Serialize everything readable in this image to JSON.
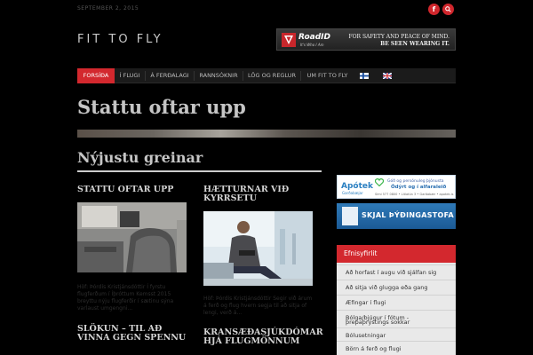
{
  "header": {
    "date": "SEPTEMBER 2, 2015",
    "site_title": "FIT TO FLY",
    "social": [
      {
        "icon": "facebook-icon",
        "glyph": "f"
      },
      {
        "icon": "search-icon"
      }
    ]
  },
  "banner": {
    "brand": "RoadID",
    "tagline": "It's Who I Am",
    "line1": "FOR SAFETY AND PEACE OF MIND.",
    "line2": "BE SEEN WEARING IT."
  },
  "nav": {
    "items": [
      {
        "label": "FORSÍÐA",
        "active": true
      },
      {
        "label": "Í FLUGI",
        "active": false
      },
      {
        "label": "Á FERÐALAGI",
        "active": false
      },
      {
        "label": "RANNSÓKNIR",
        "active": false
      },
      {
        "label": "LÖG OG REGLUR",
        "active": false
      },
      {
        "label": "UM FIT TO FLY",
        "active": false
      }
    ],
    "flags": [
      "finland-flag-icon",
      "uk-flag-icon"
    ]
  },
  "hero": {
    "title": "Stattu oftar upp"
  },
  "latest": {
    "heading": "Nýjustu greinar",
    "posts": [
      {
        "title": "STATTU OFTAR UPP",
        "excerpt": "Höf: Þórdís Kristjánsdóttir Í fyrstu flugferðum í Íþróttum Kemsst 2015 breyttu nýju flugferðir í sætinu sýna varlaust umgengni..."
      },
      {
        "title": "HÆTTURNAR VIÐ KYRRSETU",
        "excerpt": "Höf: Þórdís Kristjánsdóttir Segir við árum á ferð og flug hvern segja til að sitja of lengi, verð á..."
      },
      {
        "title": "SLÖKUN – TIL AÐ VINNA GEGN SPENNU"
      },
      {
        "title": "KRANSÆÐASJÚKDÓMAR HJÁ FLUGMÖNNUM"
      }
    ]
  },
  "sidebar": {
    "ad1": {
      "name": "Apótek",
      "sub": "Garðabæjar",
      "l1": "Góð og persónuleg þjónusta",
      "l2": "Ódýrt og í alfaraleið",
      "l3": "Sími 577 0800 • Litlatún 3 • Garðabær • apotek.is"
    },
    "ad2": {
      "text": "SKJAL ÞÝÐINGASTOFA"
    },
    "toc": {
      "heading": "Efnisyfirlit",
      "items": [
        "Að horfast í augu við sjálfan sig",
        "Að sitja við glugga eða gang",
        "Æfingar í flugi",
        "Bólga/bjúgur í fótum -",
        "þrepaþrýstings sokkar",
        "Bólusetningar",
        "Börn á ferð og flugi"
      ]
    }
  }
}
